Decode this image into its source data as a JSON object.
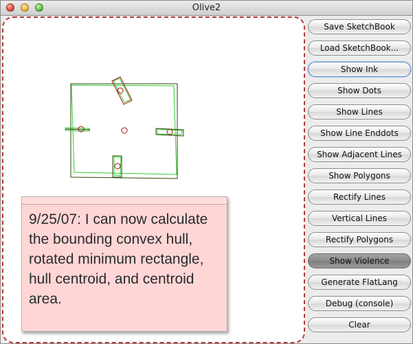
{
  "window": {
    "title": "Olive2"
  },
  "note": {
    "text": "9/25/07: I can now calculate the bounding convex hull, rotated minimum rectangle, hull centroid, and centroid area."
  },
  "buttons": [
    {
      "label": "Save SketchBook",
      "state": "normal"
    },
    {
      "label": "Load SketchBook...",
      "state": "normal"
    },
    {
      "label": "Show Ink",
      "state": "default"
    },
    {
      "label": "Show Dots",
      "state": "normal"
    },
    {
      "label": "Show Lines",
      "state": "normal"
    },
    {
      "label": "Show Line Enddots",
      "state": "normal"
    },
    {
      "label": "Show Adjacent Lines",
      "state": "normal"
    },
    {
      "label": "Show Polygons",
      "state": "normal"
    },
    {
      "label": "Rectify Lines",
      "state": "normal"
    },
    {
      "label": "Vertical Lines",
      "state": "normal"
    },
    {
      "label": "Rectify Polygons",
      "state": "normal"
    },
    {
      "label": "Show Violence",
      "state": "pressed"
    },
    {
      "label": "Generate FlatLang",
      "state": "normal"
    },
    {
      "label": "Debug (console)",
      "state": "normal"
    },
    {
      "label": "Clear",
      "state": "normal"
    }
  ],
  "colors": {
    "hull": "#33cc33",
    "rectangle": "#2a4a00",
    "centroid": "#a01010",
    "canvas_border": "#b33a3a"
  }
}
